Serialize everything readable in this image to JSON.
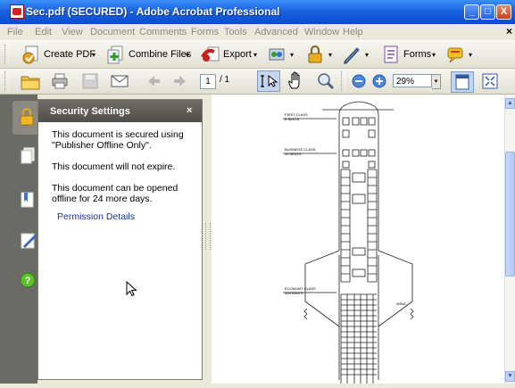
{
  "window": {
    "title": "Sec.pdf (SECURED) - Adobe Acrobat Professional",
    "minimize_label": "_",
    "maximize_label": "□",
    "close_label": "X"
  },
  "menu": {
    "items": [
      {
        "label": "File"
      },
      {
        "label": "Edit"
      },
      {
        "label": "View"
      },
      {
        "label": "Document"
      },
      {
        "label": "Comments"
      },
      {
        "label": "Forms"
      },
      {
        "label": "Tools"
      },
      {
        "label": "Advanced"
      },
      {
        "label": "Window"
      },
      {
        "label": "Help"
      }
    ],
    "doc_close_label": "×"
  },
  "toolbar": {
    "create_pdf_label": "Create PDF",
    "combine_files_label": "Combine Files",
    "export_label": "Export",
    "forms_label": "Forms",
    "dropdown_caret": "▾"
  },
  "navigation": {
    "current_page": "1",
    "total_pages": "/ 1",
    "zoom_value": "29%",
    "zoom_caret": "▾"
  },
  "security_panel": {
    "title": "Security Settings",
    "close_label": "×",
    "line1": "This document is secured using \"Publisher Offline Only\".",
    "line2": "This document will not expire.",
    "line3": "This document can be opened offline for 24 more days.",
    "link": "Permission Details"
  },
  "scrollbar": {
    "up_arrow": "▲",
    "down_arrow": "▼"
  },
  "seatmap": {
    "first_class_label": "FIRST CLASS\n8 SEATS",
    "business_class_label": "BUSINESS CLASS\n40 SEATS",
    "economy_class_label": "ECONOMY CLASS\n328 SEATS",
    "wing_label": "WING"
  }
}
